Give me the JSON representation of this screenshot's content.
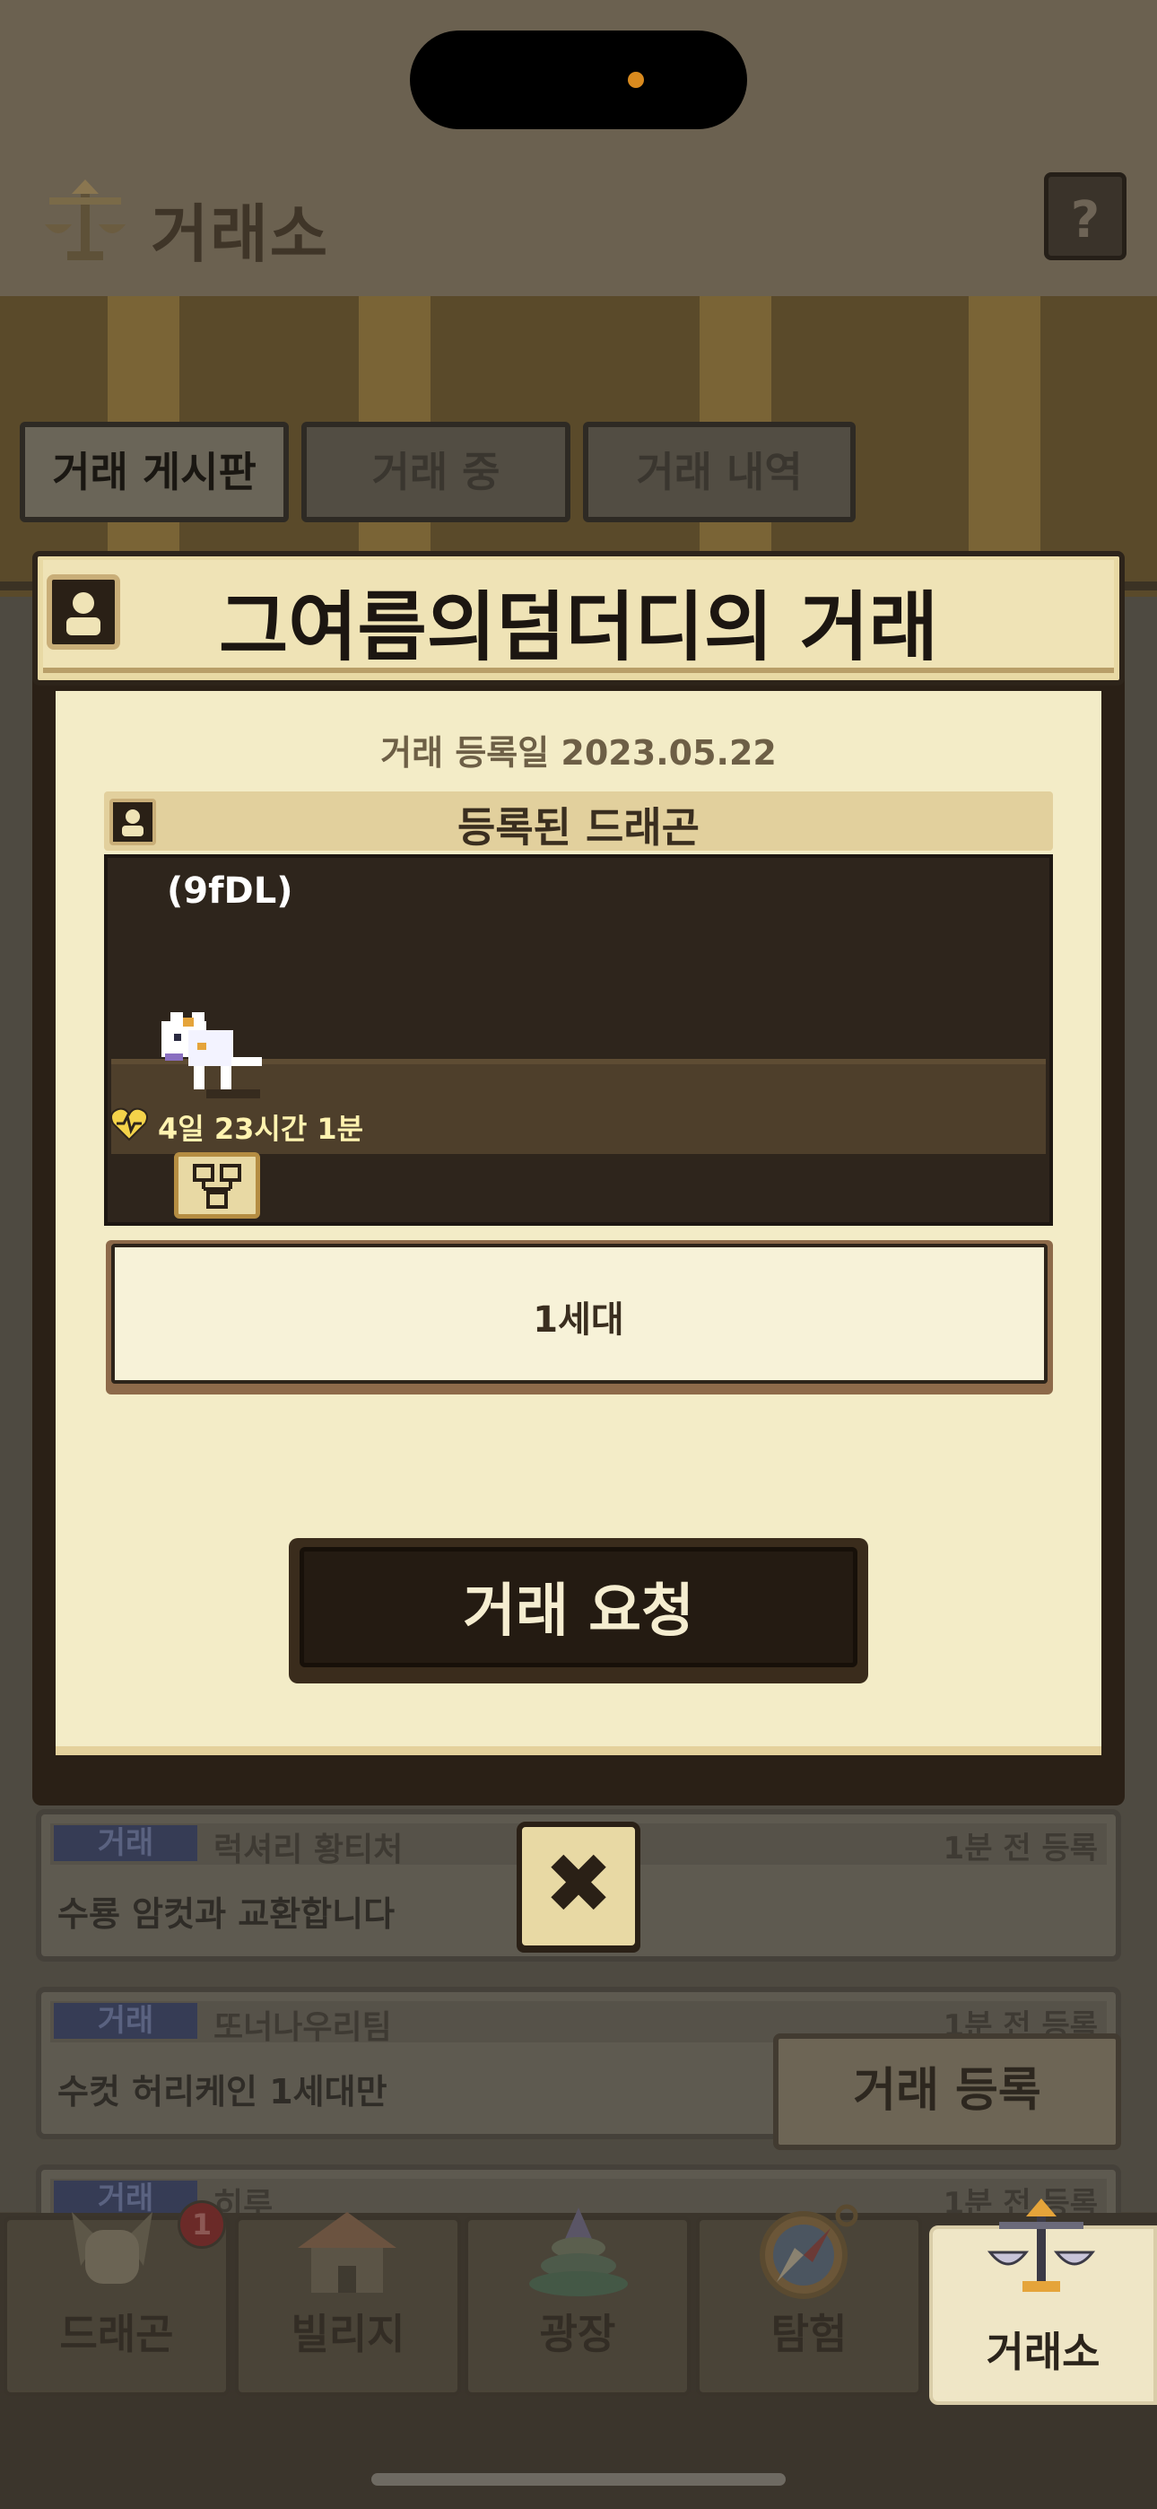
{
  "header": {
    "title": "거래소",
    "help_label": "?"
  },
  "tabs": [
    {
      "label": "거래 게시판",
      "active": true
    },
    {
      "label": "거래 중",
      "active": false
    },
    {
      "label": "거래 내역",
      "active": false
    }
  ],
  "modal": {
    "title": "그여름의덤더디의 거래",
    "registered_date": "거래 등록일 2023.05.22",
    "dragon_section_title": "등록된 드래곤",
    "dragon_id": "(9fDL)",
    "timer": "4일 23시간 1분",
    "generation": "1세대",
    "request_button": "거래 요청",
    "close_label": "✖"
  },
  "list": [
    {
      "badge": "거래",
      "user": "럭셔리 황티처",
      "time": "1분 전 등록",
      "desc": "수룡 암컷과 교환합니다"
    },
    {
      "badge": "거래",
      "user": "또너나우리팀",
      "time": "1분 전 등록",
      "desc": "수컷 허리케인 1세대만"
    },
    {
      "badge": "거래",
      "user": "히루",
      "time": "1분 전 등록",
      "desc": ""
    }
  ],
  "register_button": "거래 등록",
  "nav": [
    {
      "label": "드래곤",
      "badge": "1",
      "icon": "dragon-icon"
    },
    {
      "label": "빌리지",
      "icon": "village-icon"
    },
    {
      "label": "광장",
      "icon": "plaza-icon"
    },
    {
      "label": "탐험",
      "icon": "compass-icon"
    },
    {
      "label": "거래소",
      "icon": "scale-icon",
      "active": true
    }
  ],
  "colors": {
    "modal_bg": "#f3ecc7",
    "button_dark": "#241b12",
    "accent_gold": "#e8d9a4"
  }
}
